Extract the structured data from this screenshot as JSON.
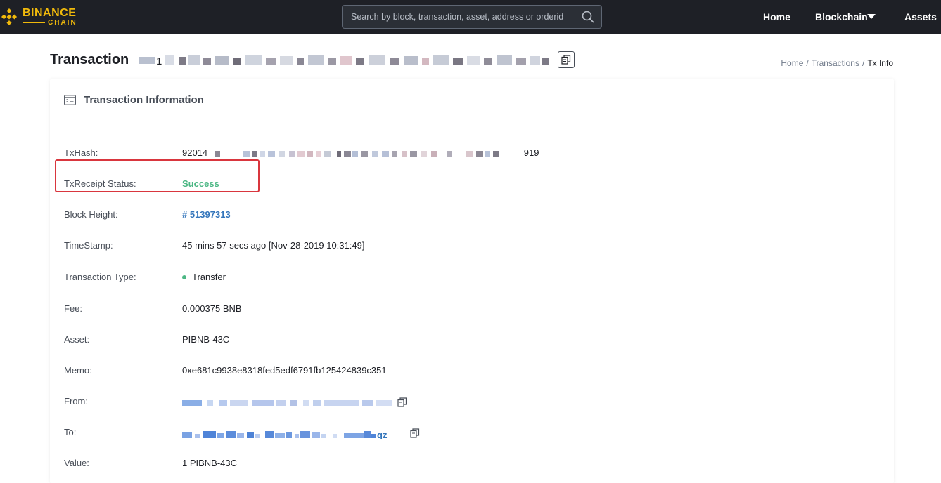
{
  "brand": {
    "line1": "BINANCE",
    "line2": "CHAIN",
    "color": "#f0b90b"
  },
  "search": {
    "placeholder": "Search by block, transaction, asset, address or orderid",
    "icon": "search-icon"
  },
  "nav": {
    "home": "Home",
    "blockchain": "Blockchain",
    "assets": "Assets"
  },
  "page": {
    "title": "Transaction",
    "hash_prefix": "1",
    "copy_icon": "copy-icon"
  },
  "breadcrumb": {
    "home": "Home",
    "sep1": "/",
    "transactions": "Transactions",
    "sep2": "/",
    "current": "Tx Info"
  },
  "card": {
    "title": "Transaction Information",
    "icon": "document-icon"
  },
  "fields": {
    "txhash": {
      "label": "TxHash:",
      "prefix": "92014",
      "suffix": "919"
    },
    "status": {
      "label": "TxReceipt Status:",
      "value": "Success"
    },
    "block": {
      "label": "Block Height:",
      "value": "# 51397313"
    },
    "timestamp": {
      "label": "TimeStamp:",
      "value": "45 mins 57 secs ago [Nov-28-2019 10:31:49]"
    },
    "type": {
      "label": "Transaction Type:",
      "value": "Transfer"
    },
    "fee": {
      "label": "Fee:",
      "value": "0.000375 BNB"
    },
    "asset": {
      "label": "Asset:",
      "value": "PIBNB-43C"
    },
    "memo": {
      "label": "Memo:",
      "value": "0xe681c9938e8318fed5edf6791fb125424839c351"
    },
    "from": {
      "label": "From:"
    },
    "to": {
      "label": "To:",
      "suffix": "qz"
    },
    "amount": {
      "label": "Value:",
      "value": "1 PIBNB-43C"
    }
  },
  "colors": {
    "navbar": "#1e2026",
    "success": "#4cb784",
    "link": "#3375bb",
    "highlight": "#d9363e"
  }
}
